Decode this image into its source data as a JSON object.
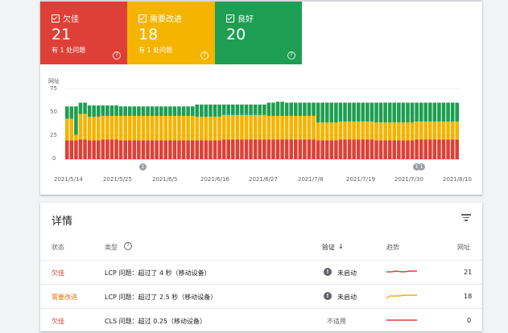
{
  "summary": {
    "tiles": [
      {
        "label": "欠佳",
        "count": "21",
        "sub": "有 1 处问题",
        "color": "#de4037"
      },
      {
        "label": "需要改进",
        "count": "18",
        "sub": "有 1 处问题",
        "color": "#f4b400"
      },
      {
        "label": "良好",
        "count": "20",
        "sub": "",
        "color": "#1e9e52"
      }
    ]
  },
  "chart_data": {
    "type": "bar",
    "ylabel": "网址",
    "yticks": [
      0,
      25,
      50,
      75
    ],
    "ylim": [
      0,
      75
    ],
    "x_tick_labels": [
      "2021/5/14",
      "2021/5/25",
      "2021/6/5",
      "2021/6/16",
      "2021/6/27",
      "2021/7/8",
      "2021/7/19",
      "2021/7/30",
      "2021/8/10"
    ],
    "start_date": "2021/5/14",
    "end_date": "2021/8/10",
    "stack_order": [
      "欠佳",
      "需要改进",
      "良好"
    ],
    "series": [
      {
        "name": "欠佳",
        "color": "#de4037",
        "segments": [
          [
            1,
            20
          ],
          [
            4,
            21
          ],
          [
            6,
            20
          ],
          [
            9,
            21
          ],
          [
            13,
            20
          ],
          [
            36,
            21
          ],
          [
            57,
            20
          ],
          [
            62,
            21
          ],
          [
            70,
            20
          ],
          [
            79,
            21
          ],
          [
            90,
            20
          ],
          [
            97,
            21
          ]
        ]
      },
      {
        "name": "需要改进",
        "color": "#f4b400",
        "segments": [
          [
            1,
            23
          ],
          [
            3,
            6
          ],
          [
            4,
            27
          ],
          [
            6,
            25
          ],
          [
            9,
            25
          ],
          [
            13,
            26
          ],
          [
            30,
            25
          ],
          [
            36,
            26
          ],
          [
            46,
            25
          ],
          [
            57,
            19
          ],
          [
            62,
            19
          ],
          [
            70,
            19
          ],
          [
            79,
            19
          ],
          [
            90,
            19
          ],
          [
            97,
            18
          ]
        ]
      },
      {
        "name": "良好",
        "color": "#1e9e52",
        "segments": [
          [
            1,
            13
          ],
          [
            3,
            30
          ],
          [
            4,
            12
          ],
          [
            6,
            12
          ],
          [
            9,
            11
          ],
          [
            13,
            10
          ],
          [
            30,
            13
          ],
          [
            36,
            11
          ],
          [
            46,
            14
          ],
          [
            48,
            15
          ],
          [
            50,
            14
          ],
          [
            57,
            21
          ],
          [
            62,
            20
          ],
          [
            70,
            21
          ],
          [
            79,
            20
          ],
          [
            90,
            21
          ],
          [
            97,
            21
          ]
        ]
      }
    ],
    "annotations": [
      {
        "date": "2021/5/25",
        "text": "1"
      },
      {
        "date": "2021/8/1",
        "text": "1"
      },
      {
        "date": "2021/8/2",
        "text": "1"
      }
    ]
  },
  "details": {
    "title": "详情",
    "headers": {
      "status": "状态",
      "type": "类型",
      "validation": "验证",
      "trend": "趋势",
      "urls": "网址"
    },
    "rows": [
      {
        "status": "欠佳",
        "status_kind": "poor",
        "type": "LCP 问题：超过了 4 秒（移动设备）",
        "validation": "未启动",
        "urls": "21",
        "spark_color": "#de4037"
      },
      {
        "status": "需要改进",
        "status_kind": "ni",
        "type": "LCP 问题：超过了 2.5 秒（移动设备）",
        "validation": "未启动",
        "urls": "18",
        "spark_color": "#f4b400"
      },
      {
        "status": "欠佳",
        "status_kind": "poor",
        "type": "CLS 问题：超过 0.25（移动设备）",
        "validation": "不适用",
        "urls": "0",
        "spark_color": "#de4037"
      }
    ]
  }
}
